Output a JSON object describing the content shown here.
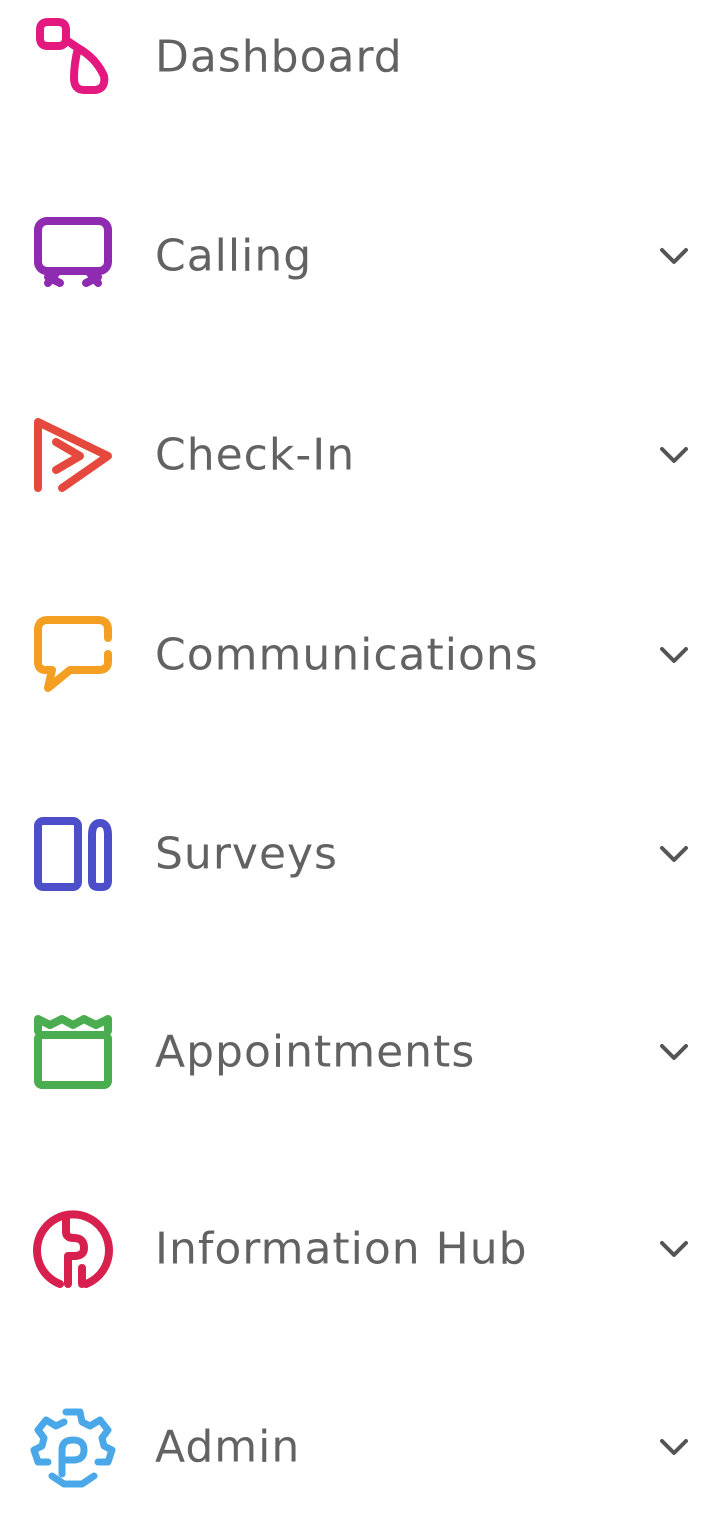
{
  "nav": {
    "items": [
      {
        "label": "Dashboard",
        "icon": "dashboard-icon",
        "color": "#e3197f",
        "has_submenu": false
      },
      {
        "label": "Calling",
        "icon": "calling-icon",
        "color": "#8e2bb1",
        "has_submenu": true
      },
      {
        "label": "Check-In",
        "icon": "check-in-icon",
        "color": "#e5493d",
        "has_submenu": true
      },
      {
        "label": "Communications",
        "icon": "communications-icon",
        "color": "#f49e22",
        "has_submenu": true
      },
      {
        "label": "Surveys",
        "icon": "surveys-icon",
        "color": "#4c4fc9",
        "has_submenu": true
      },
      {
        "label": "Appointments",
        "icon": "appointments-icon",
        "color": "#4aad4f",
        "has_submenu": true
      },
      {
        "label": "Information Hub",
        "icon": "information-hub-icon",
        "color": "#d8204f",
        "has_submenu": true
      },
      {
        "label": "Admin",
        "icon": "admin-icon",
        "color": "#4aa8e9",
        "has_submenu": true
      }
    ]
  }
}
